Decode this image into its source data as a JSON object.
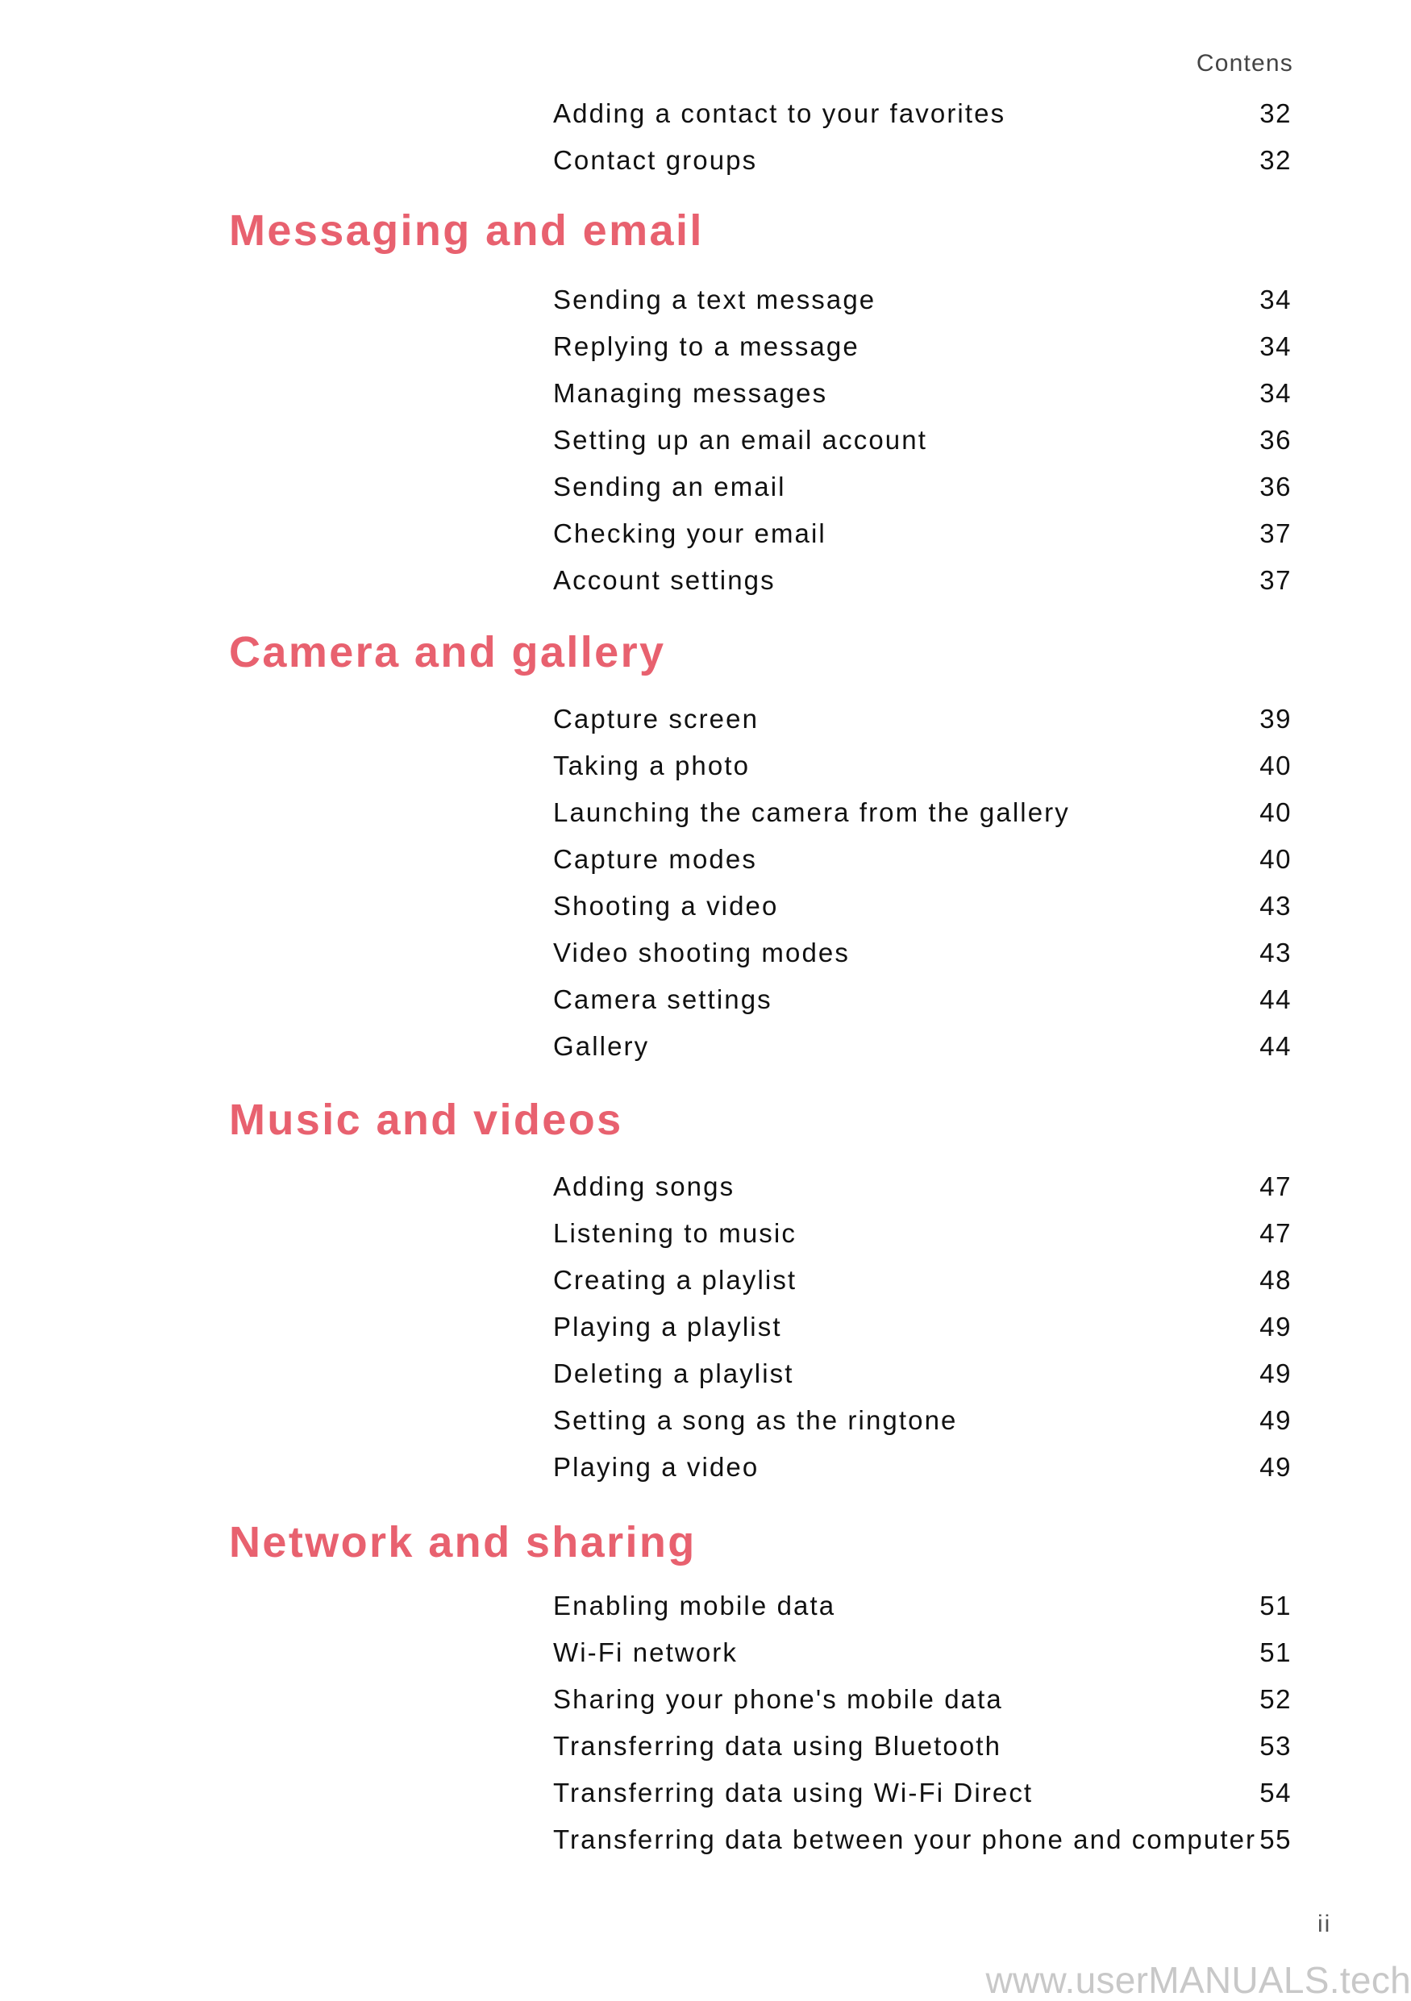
{
  "header": {
    "running_title": "Contens"
  },
  "continued_entries": [
    {
      "title": "Adding a contact to your favorites",
      "page": "32"
    },
    {
      "title": "Contact groups",
      "page": "32"
    }
  ],
  "sections": [
    {
      "heading": "Messaging and email",
      "entries": [
        {
          "title": "Sending a text message",
          "page": "34"
        },
        {
          "title": "Replying to a message",
          "page": "34"
        },
        {
          "title": "Managing messages",
          "page": "34"
        },
        {
          "title": "Setting up an email account",
          "page": "36"
        },
        {
          "title": "Sending an email",
          "page": "36"
        },
        {
          "title": "Checking your email",
          "page": "37"
        },
        {
          "title": "Account settings",
          "page": "37"
        }
      ]
    },
    {
      "heading": "Camera and gallery",
      "entries": [
        {
          "title": "Capture screen",
          "page": "39"
        },
        {
          "title": "Taking a photo",
          "page": "40"
        },
        {
          "title": "Launching the camera from the gallery",
          "page": "40"
        },
        {
          "title": "Capture modes",
          "page": "40"
        },
        {
          "title": "Shooting a video",
          "page": "43"
        },
        {
          "title": "Video shooting modes",
          "page": "43"
        },
        {
          "title": "Camera settings",
          "page": "44"
        },
        {
          "title": "Gallery",
          "page": "44"
        }
      ]
    },
    {
      "heading": "Music and videos",
      "entries": [
        {
          "title": "Adding songs",
          "page": "47"
        },
        {
          "title": "Listening to music",
          "page": "47"
        },
        {
          "title": "Creating a playlist",
          "page": "48"
        },
        {
          "title": "Playing a playlist",
          "page": "49"
        },
        {
          "title": "Deleting a playlist",
          "page": "49"
        },
        {
          "title": "Setting a song as the ringtone",
          "page": "49"
        },
        {
          "title": "Playing a video",
          "page": "49"
        }
      ]
    },
    {
      "heading": "Network and sharing",
      "entries": [
        {
          "title": "Enabling mobile data",
          "page": "51"
        },
        {
          "title": "Wi-Fi network",
          "page": "51"
        },
        {
          "title": "Sharing your phone's mobile data",
          "page": "52"
        },
        {
          "title": "Transferring data using Bluetooth",
          "page": "53"
        },
        {
          "title": "Transferring data using Wi-Fi Direct",
          "page": "54"
        },
        {
          "title": "Transferring data between your phone and computer",
          "page": "55"
        }
      ]
    }
  ],
  "footer": {
    "page_number": "ii",
    "watermark": "www.userMANUALS.tech"
  },
  "colors": {
    "heading": "#e8616f",
    "body_text": "#111111",
    "running_header": "#444444",
    "watermark": "#c8c8c8"
  }
}
